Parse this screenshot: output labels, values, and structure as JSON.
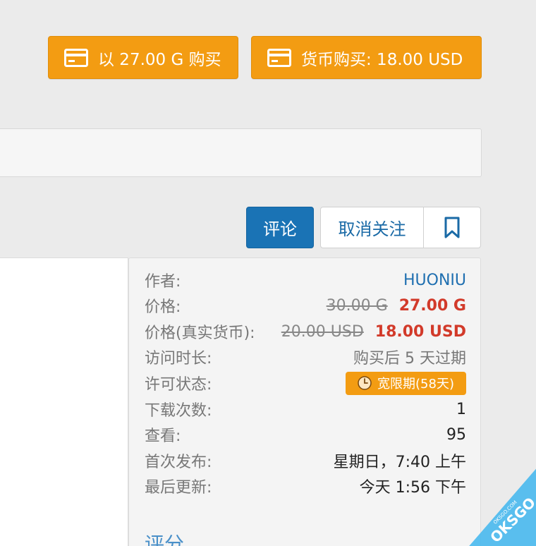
{
  "purchase": {
    "gold_button_label": "以 27.00 G 购买",
    "currency_button_label": "货币购买: 18.00 USD"
  },
  "actions": {
    "review_label": "评论",
    "unwatch_label": "取消关注"
  },
  "info": {
    "author_label": "作者:",
    "author_value": "HUONIU",
    "price_label": "价格:",
    "price_old": "30.00 G",
    "price_new": "27.00 G",
    "real_price_label": "价格(真实货币):",
    "real_price_old": "20.00 USD",
    "real_price_new": "18.00 USD",
    "access_label": "访问时长:",
    "access_value": "购买后 5 天过期",
    "license_label": "许可状态:",
    "license_badge": "宽限期(58天)",
    "downloads_label": "下载次数:",
    "downloads_value": "1",
    "views_label": "查看:",
    "views_value": "95",
    "first_release_label": "首次发布:",
    "first_release_value": "星期日，7:40 上午",
    "last_update_label": "最后更新:",
    "last_update_value": "今天 1:56 下午",
    "rating_title": "评分"
  },
  "watermark": {
    "brand": "OKSGO",
    "domain": "OKSGO.COM"
  },
  "colors": {
    "accent_orange": "#f39c12",
    "primary_blue": "#1a73b5",
    "price_red": "#d23a2a",
    "link_blue": "#1f6fb0"
  },
  "icons": {
    "purchase": "credit-card-icon",
    "bookmark": "bookmark-icon",
    "license": "clock-icon"
  }
}
